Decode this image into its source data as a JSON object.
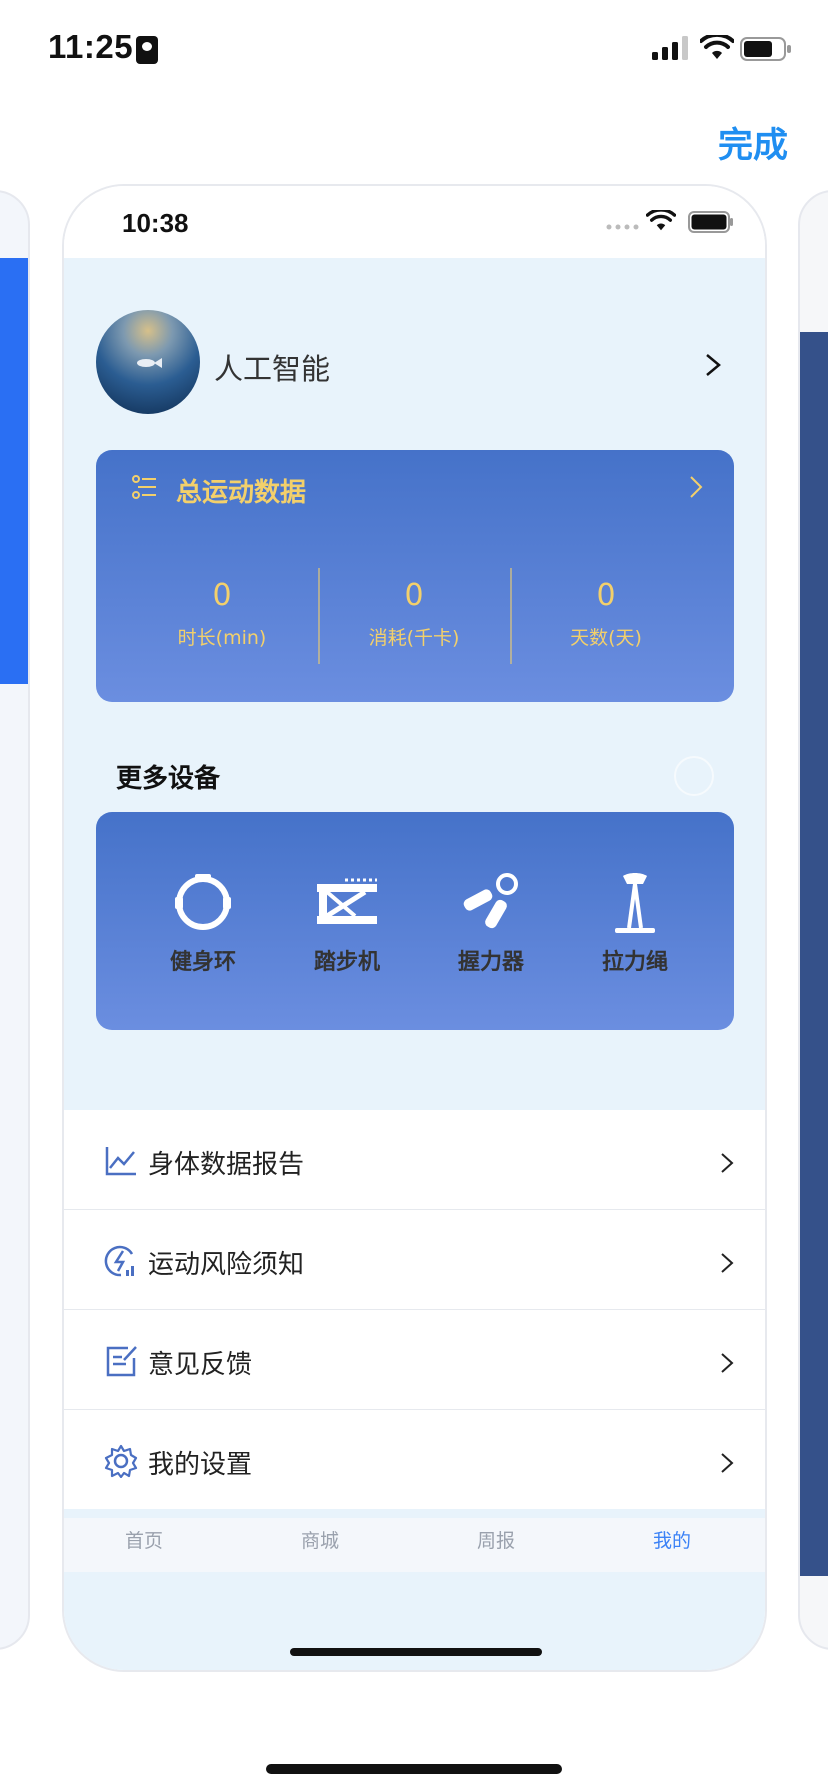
{
  "status_bar": {
    "time": "11:25"
  },
  "header": {
    "done_label": "完成"
  },
  "preview": {
    "status_time": "10:38",
    "profile": {
      "name": "人工智能"
    },
    "stats": {
      "title": "总运动数据",
      "items": [
        {
          "value": "0",
          "label": "时长(min)"
        },
        {
          "value": "0",
          "label": "消耗(千卡)"
        },
        {
          "value": "0",
          "label": "天数(天)"
        }
      ]
    },
    "devices": {
      "title": "更多设备",
      "items": [
        {
          "label": "健身环",
          "icon": "ring-icon"
        },
        {
          "label": "踏步机",
          "icon": "stepper-icon"
        },
        {
          "label": "握力器",
          "icon": "grip-icon"
        },
        {
          "label": "拉力绳",
          "icon": "rope-icon"
        }
      ]
    },
    "menu": [
      {
        "label": "身体数据报告",
        "icon": "chart-line-icon"
      },
      {
        "label": "运动风险须知",
        "icon": "risk-bolt-icon"
      },
      {
        "label": "意见反馈",
        "icon": "feedback-edit-icon"
      },
      {
        "label": "我的设置",
        "icon": "gear-icon"
      }
    ],
    "tabs": [
      {
        "label": "首页",
        "active": false
      },
      {
        "label": "商城",
        "active": false
      },
      {
        "label": "周报",
        "active": false
      },
      {
        "label": "我的",
        "active": true
      }
    ]
  },
  "colors": {
    "accent": "#1f8ef1",
    "card_gradient_top": "#4572c9",
    "card_gradient_bottom": "#6b8ee0",
    "stat_text": "#f3d06b",
    "content_bg": "#e8f3fb",
    "tab_active": "#3b82f6"
  }
}
